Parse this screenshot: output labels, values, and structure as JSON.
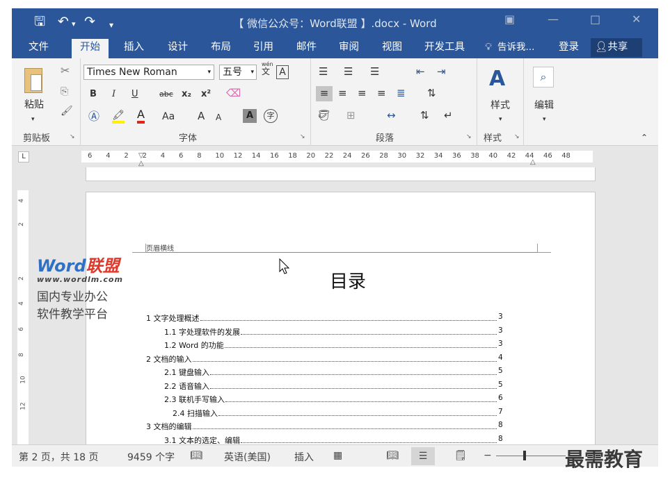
{
  "titlebar": {
    "doc_title": "【 微信公众号：Word联盟 】.docx - Word",
    "save_icon": "save-icon",
    "undo_icon": "undo-icon",
    "redo_icon": "redo-icon"
  },
  "tabs": [
    "文件",
    "开始",
    "插入",
    "设计",
    "布局",
    "引用",
    "邮件",
    "审阅",
    "视图",
    "开发工具"
  ],
  "tell_me": "告诉我...",
  "login": "登录",
  "share": "共享",
  "ribbon": {
    "clipboard": {
      "paste": "粘贴",
      "label": "剪贴板"
    },
    "font": {
      "name": "Times New Roman",
      "size": "五号",
      "wen": "wén",
      "wen_char": "文",
      "box_char": "A",
      "label": "字体",
      "bold": "B",
      "italic": "I",
      "underline": "U",
      "strike": "abc",
      "sub": "x₂",
      "sup": "x²",
      "aa": "Aa",
      "grow": "A",
      "shrink": "A",
      "char_a": "A",
      "circle": "字"
    },
    "paragraph": {
      "label": "段落"
    },
    "styles": {
      "btn": "样式",
      "label": "样式"
    },
    "editing": {
      "btn": "编辑"
    }
  },
  "ruler": {
    "ticks": [
      "6",
      "4",
      "2",
      "2",
      "4",
      "6",
      "8",
      "10",
      "12",
      "14",
      "16",
      "18",
      "20",
      "22",
      "24",
      "26",
      "28",
      "30",
      "32",
      "34",
      "36",
      "38",
      "40",
      "42",
      "44",
      "46",
      "48"
    ],
    "corner": "L"
  },
  "vruler": [
    "4",
    "2",
    "2",
    "4",
    "6",
    "8",
    "10",
    "12"
  ],
  "document": {
    "header_line_label": "页眉横线",
    "toc_title": "目录",
    "toc": [
      {
        "text": "1 文字处理概述",
        "page": "3",
        "level": 1
      },
      {
        "text": "1.1 字处理软件的发展",
        "page": "3",
        "level": 2
      },
      {
        "text": "1.2 Word 的功能",
        "page": "3",
        "level": 2
      },
      {
        "text": "2 文档的输入",
        "page": "4",
        "level": 1
      },
      {
        "text": "2.1 键盘输入",
        "page": "5",
        "level": 2
      },
      {
        "text": "2.2 语音输入",
        "page": "5",
        "level": 2
      },
      {
        "text": "2.3 联机手写输入",
        "page": "6",
        "level": 2
      },
      {
        "text": "2.4 扫描输入",
        "page": "7",
        "level": 3
      },
      {
        "text": "3 文档的编辑",
        "page": "8",
        "level": 1
      },
      {
        "text": "3.1 文本的选定、编辑",
        "page": "8",
        "level": 2
      }
    ]
  },
  "watermark": {
    "brand_a": "Word",
    "brand_b": "联盟",
    "url": "www.wordlm.com",
    "line1": "国内专业办公",
    "line2": "软件教学平台"
  },
  "status": {
    "page": "第 2 页，共 18 页",
    "words": "9459 个字",
    "lang": "英语(美国)",
    "mode": "插入"
  },
  "corner_watermark": "最需教育",
  "colors": {
    "accent": "#2b579a",
    "status_bg": "#f0f0f0",
    "brand_blue": "#2f6fc4",
    "brand_red": "#e0392b"
  }
}
